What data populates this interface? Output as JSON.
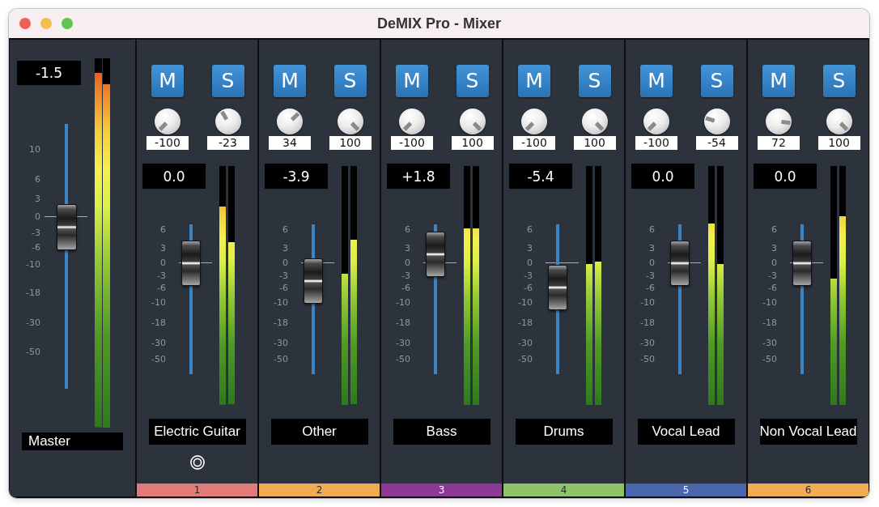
{
  "window": {
    "title": "DeMIX Pro - Mixer"
  },
  "master": {
    "name": "Master",
    "gain": "-1.5",
    "fader": {
      "level": 0.61
    },
    "scale": [
      "10",
      "6",
      "3",
      "0",
      "-3",
      "-6",
      "-10",
      "-18",
      "-30",
      "-50"
    ],
    "meters": [
      {
        "level": 0.96
      },
      {
        "level": 0.93
      }
    ]
  },
  "channels": [
    {
      "name": "Electric Guitar",
      "number": "1",
      "color": "#e07b79",
      "selected": true,
      "buttons": [
        {
          "label": "M",
          "on": false
        },
        {
          "label": "S",
          "on": false
        }
      ],
      "knobs": [
        {
          "value": "-100"
        },
        {
          "value": "-23"
        }
      ],
      "gain": "0.0",
      "fader": {
        "level": 0.74
      },
      "scale": [
        "6",
        "3",
        "0",
        "-3",
        "-6",
        "-10",
        "-18",
        "-30",
        "-50"
      ],
      "meters": [
        {
          "level": 0.83
        },
        {
          "level": 0.68
        }
      ]
    },
    {
      "name": "Other",
      "number": "2",
      "color": "#f0ac55",
      "selected": false,
      "buttons": [
        {
          "label": "M",
          "on": false
        },
        {
          "label": "S",
          "on": false
        }
      ],
      "knobs": [
        {
          "value": "34"
        },
        {
          "value": "100"
        }
      ],
      "gain": "-3.9",
      "fader": {
        "level": 0.62
      },
      "scale": [
        "6",
        "3",
        "0",
        "-3",
        "-6",
        "-10",
        "-18",
        "-30",
        "-50"
      ],
      "meters": [
        {
          "level": 0.55
        },
        {
          "level": 0.69
        }
      ]
    },
    {
      "name": "Bass",
      "number": "3",
      "color": "#8d3a97",
      "selected": false,
      "buttons": [
        {
          "label": "M",
          "on": false
        },
        {
          "label": "S",
          "on": false
        }
      ],
      "knobs": [
        {
          "value": "-100"
        },
        {
          "value": "100"
        }
      ],
      "gain": "+1.8",
      "fader": {
        "level": 0.8
      },
      "scale": [
        "6",
        "3",
        "0",
        "-3",
        "-6",
        "-10",
        "-18",
        "-30",
        "-50"
      ],
      "meters": [
        {
          "level": 0.74
        },
        {
          "level": 0.74
        }
      ]
    },
    {
      "name": "Drums",
      "number": "4",
      "color": "#8ec26b",
      "selected": false,
      "buttons": [
        {
          "label": "M",
          "on": false
        },
        {
          "label": "S",
          "on": false
        }
      ],
      "knobs": [
        {
          "value": "-100"
        },
        {
          "value": "100"
        }
      ],
      "gain": "-5.4",
      "fader": {
        "level": 0.58
      },
      "scale": [
        "6",
        "3",
        "0",
        "-3",
        "-6",
        "-10",
        "-18",
        "-30",
        "-50"
      ],
      "meters": [
        {
          "level": 0.59
        },
        {
          "level": 0.6
        }
      ]
    },
    {
      "name": "Vocal Lead",
      "number": "5",
      "color": "#4a67ad",
      "selected": false,
      "buttons": [
        {
          "label": "M",
          "on": false
        },
        {
          "label": "S",
          "on": false
        }
      ],
      "knobs": [
        {
          "value": "-100"
        },
        {
          "value": "-54"
        }
      ],
      "gain": "0.0",
      "fader": {
        "level": 0.74
      },
      "scale": [
        "6",
        "3",
        "0",
        "-3",
        "-6",
        "-10",
        "-18",
        "-30",
        "-50"
      ],
      "meters": [
        {
          "level": 0.76
        },
        {
          "level": 0.59
        }
      ]
    },
    {
      "name": "Non Vocal Lead",
      "number": "6",
      "color": "#f0ac55",
      "selected": false,
      "buttons": [
        {
          "label": "M",
          "on": false
        },
        {
          "label": "S",
          "on": false
        }
      ],
      "knobs": [
        {
          "value": "72"
        },
        {
          "value": "100"
        }
      ],
      "gain": "0.0",
      "fader": {
        "level": 0.74
      },
      "scale": [
        "6",
        "3",
        "0",
        "-3",
        "-6",
        "-10",
        "-18",
        "-30",
        "-50"
      ],
      "meters": [
        {
          "level": 0.53
        },
        {
          "level": 0.79
        }
      ]
    }
  ]
}
